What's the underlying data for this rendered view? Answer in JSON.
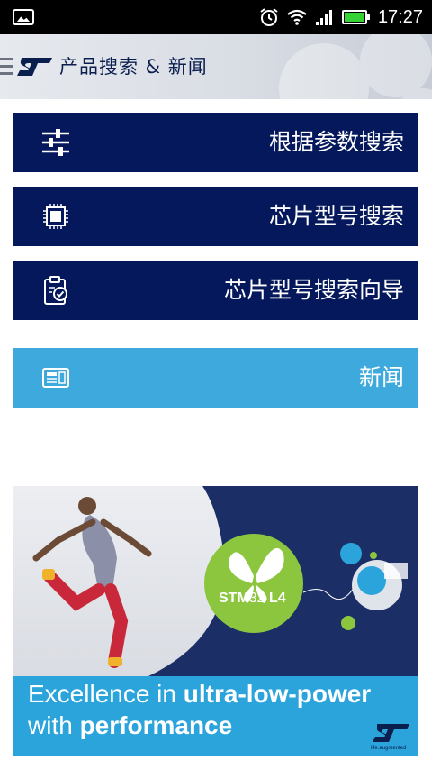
{
  "status_bar": {
    "time": "17:27",
    "icons": [
      "picture-icon",
      "alarm-icon",
      "wifi-icon",
      "signal-icon",
      "battery-icon"
    ],
    "battery_color": "#35d336"
  },
  "app_bar": {
    "title": "产品搜索 & 新闻",
    "logo": "ST"
  },
  "menu": {
    "items": [
      {
        "label": "根据参数搜索",
        "icon": "sliders-icon",
        "color": "#04185b"
      },
      {
        "label": "芯片型号搜索",
        "icon": "chip-icon",
        "color": "#04185b"
      },
      {
        "label": "芯片型号搜索向导",
        "icon": "clipboard-check-icon",
        "color": "#04185b"
      },
      {
        "label": "新闻",
        "icon": "newspaper-icon",
        "color": "#3ea9dd"
      }
    ]
  },
  "banner": {
    "badge_bold": "STM",
    "badge_thin": "32",
    "badge_suffix": " L4",
    "line1_plain": "Excellence in ",
    "line1_bold": "ultra-low-power",
    "line2_plain": "with ",
    "line2_bold": "performance",
    "footer_logo": "ST",
    "footer_tagline": "life.augmented"
  }
}
